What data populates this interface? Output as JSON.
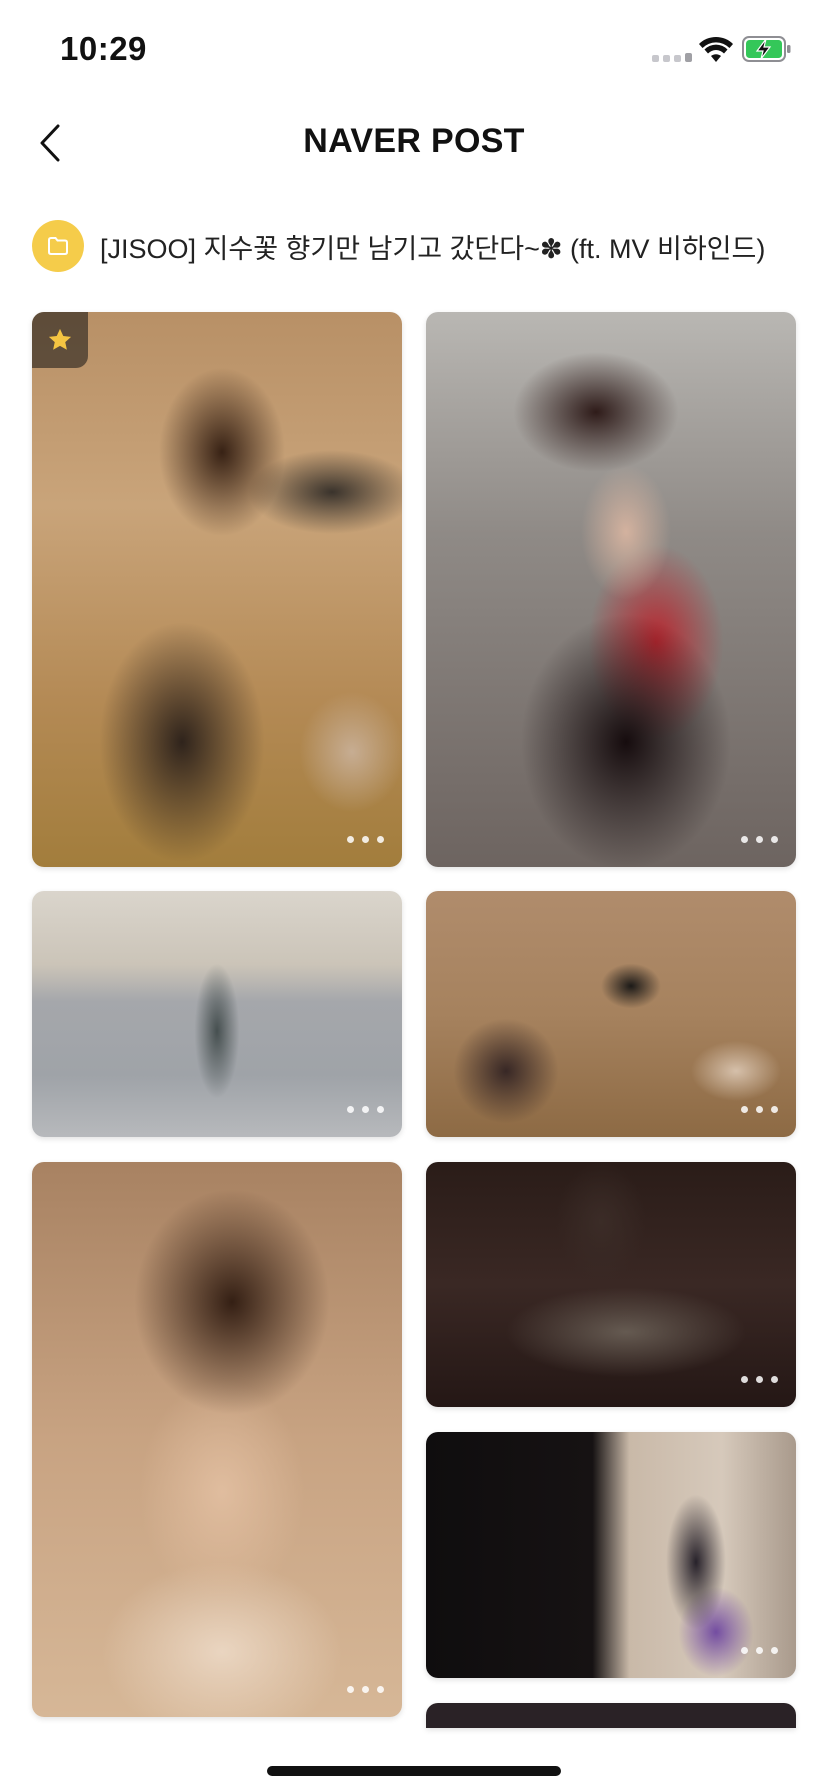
{
  "status_bar": {
    "time": "10:29"
  },
  "nav": {
    "title": "NAVER POST"
  },
  "folder": {
    "title": "[JISOO] 지수꽃 향기만 남기고 갔단다~✽ (ft. MV 비하인드)"
  },
  "colors": {
    "folder_accent": "#f5cc4a",
    "battery_green": "#34c759",
    "star": "#f5c542"
  },
  "icons": {
    "back": "chevron-left-icon",
    "folder": "folder-icon",
    "star": "star-icon",
    "more": "more-dots-icon",
    "wifi": "wifi-icon",
    "battery": "battery-charging-icon"
  },
  "photos": [
    {
      "starred": true
    },
    {
      "starred": false
    },
    {
      "starred": false
    },
    {
      "starred": false
    },
    {
      "starred": false
    },
    {
      "starred": false
    },
    {
      "starred": false
    },
    {
      "starred": false
    }
  ]
}
